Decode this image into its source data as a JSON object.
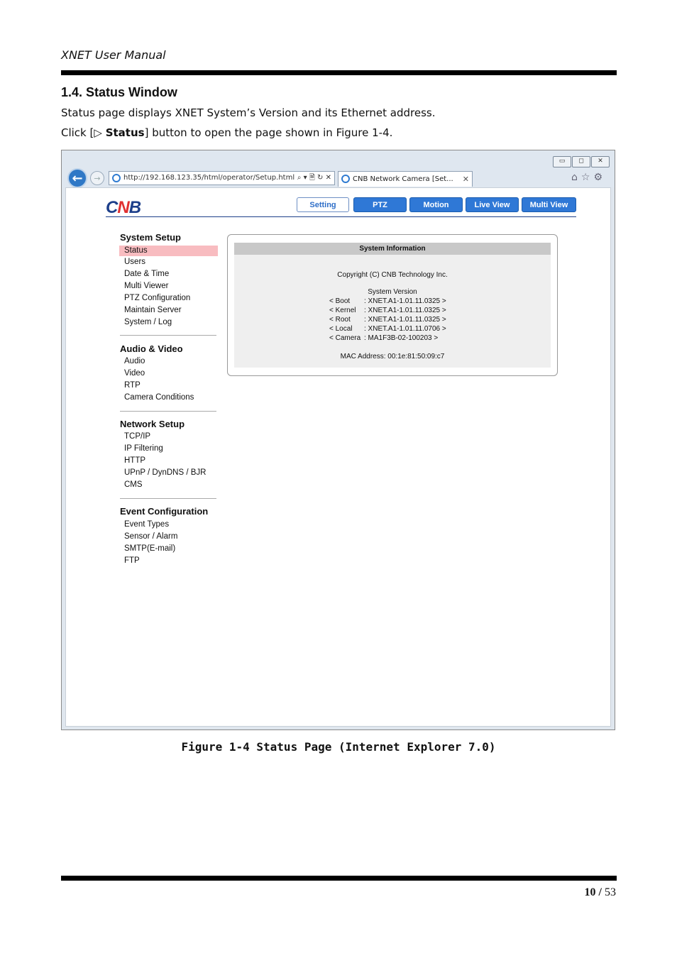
{
  "header": {
    "title": "XNET User Manual"
  },
  "section": {
    "heading": "1.4. Status Window",
    "para1": "Status page displays XNET System’s Version and its Ethernet address.",
    "para2_pre": "Click [",
    "para2_icon": "▷",
    "para2_bold": "Status",
    "para2_post": "] button to open the page shown in Figure 1-4."
  },
  "browser": {
    "address": "http://192.168.123.35/html/operator/Setup.html",
    "address_controls": "⌕ ▾ 🗎 ↻ ✕",
    "tab_title": "CNB Network Camera [Set...",
    "tab_close": "✕",
    "win_min": "▭",
    "win_max": "◻",
    "win_close": "✕",
    "toolbar_icons": "⌂☆⚙",
    "back_glyph": "←",
    "fwd_glyph": "→"
  },
  "app": {
    "logo_pre": "C",
    "logo_n": "N",
    "logo_post": "B",
    "nav": [
      "Setting",
      "PTZ",
      "Motion",
      "Live View",
      "Multi View"
    ],
    "menu": {
      "system_setup": {
        "title": "System Setup",
        "items": [
          "Status",
          "Users",
          "Date & Time",
          "Multi Viewer",
          "PTZ Configuration",
          "Maintain Server",
          "System / Log"
        ]
      },
      "audio_video": {
        "title": "Audio & Video",
        "items": [
          "Audio",
          "Video",
          "RTP",
          "Camera Conditions"
        ]
      },
      "network_setup": {
        "title": "Network Setup",
        "items": [
          "TCP/IP",
          "IP Filtering",
          "HTTP",
          "UPnP / DynDNS / BJR",
          "CMS"
        ]
      },
      "event_config": {
        "title": "Event Configuration",
        "items": [
          "Event Types",
          "Sensor / Alarm",
          "SMTP(E-mail)",
          "FTP"
        ]
      }
    },
    "system_info": {
      "title": "System Information",
      "copyright": "Copyright (C) CNB Technology Inc.",
      "version_label": "System Version",
      "versions": [
        {
          "label": "< Boot",
          "value": ": XNET.A1-1.01.11.0325 >"
        },
        {
          "label": "< Kernel",
          "value": ": XNET.A1-1.01.11.0325 >"
        },
        {
          "label": "< Root",
          "value": ": XNET.A1-1.01.11.0325 >"
        },
        {
          "label": "< Local",
          "value": ": XNET.A1-1.01.11.0706 >"
        },
        {
          "label": "< Camera",
          "value": ": MA1F3B-02-100203 >"
        }
      ],
      "mac": "MAC Address: 00:1e:81:50:09:c7"
    }
  },
  "caption": "Figure 1-4 Status Page (Internet Explorer 7.0)",
  "footer": {
    "page_current": "10",
    "page_sep": "/",
    "page_total": "53"
  }
}
